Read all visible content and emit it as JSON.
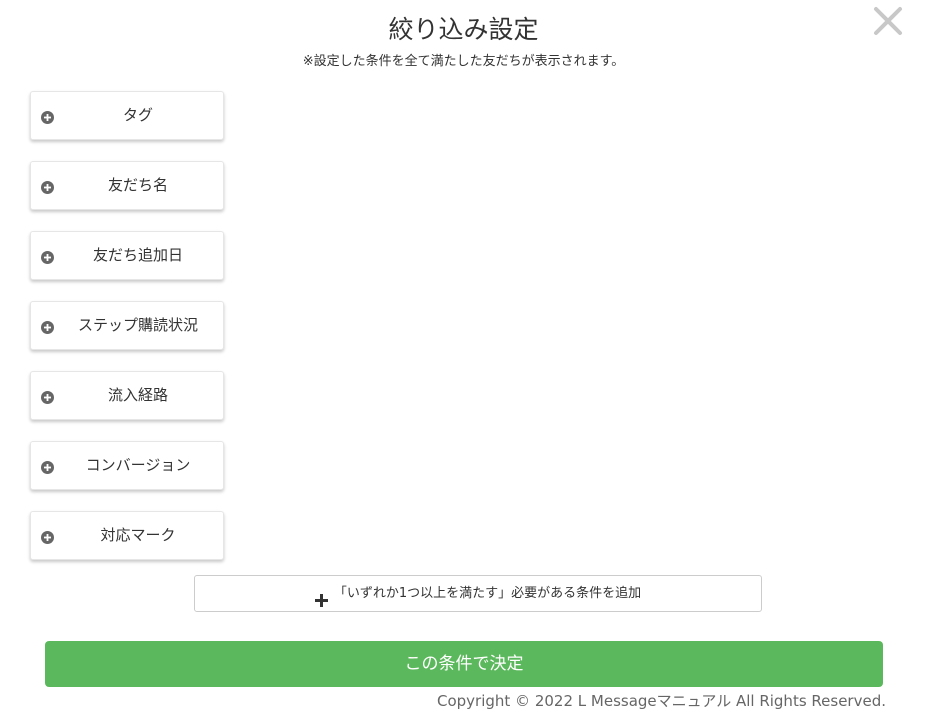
{
  "modal": {
    "title": "絞り込み設定",
    "subtitle": "※設定した条件を全て満たした友だちが表示されます。",
    "close_icon": "close-icon"
  },
  "filters": [
    {
      "label": "タグ",
      "icon": "plus-circle-icon"
    },
    {
      "label": "友だち名",
      "icon": "plus-circle-icon"
    },
    {
      "label": "友だち追加日",
      "icon": "plus-circle-icon"
    },
    {
      "label": "ステップ購読状況",
      "icon": "plus-circle-icon"
    },
    {
      "label": "流入経路",
      "icon": "plus-circle-icon"
    },
    {
      "label": "コンバージョン",
      "icon": "plus-circle-icon"
    },
    {
      "label": "対応マーク",
      "icon": "plus-circle-icon"
    }
  ],
  "add_condition": {
    "label": "「いずれか1つ以上を満たす」必要がある条件を追加",
    "icon": "plus-icon"
  },
  "submit": {
    "label": "この条件で決定",
    "color": "#5cb85c"
  },
  "footer": {
    "copyright": "Copyright © 2022 L Messageマニュアル All Rights Reserved."
  }
}
